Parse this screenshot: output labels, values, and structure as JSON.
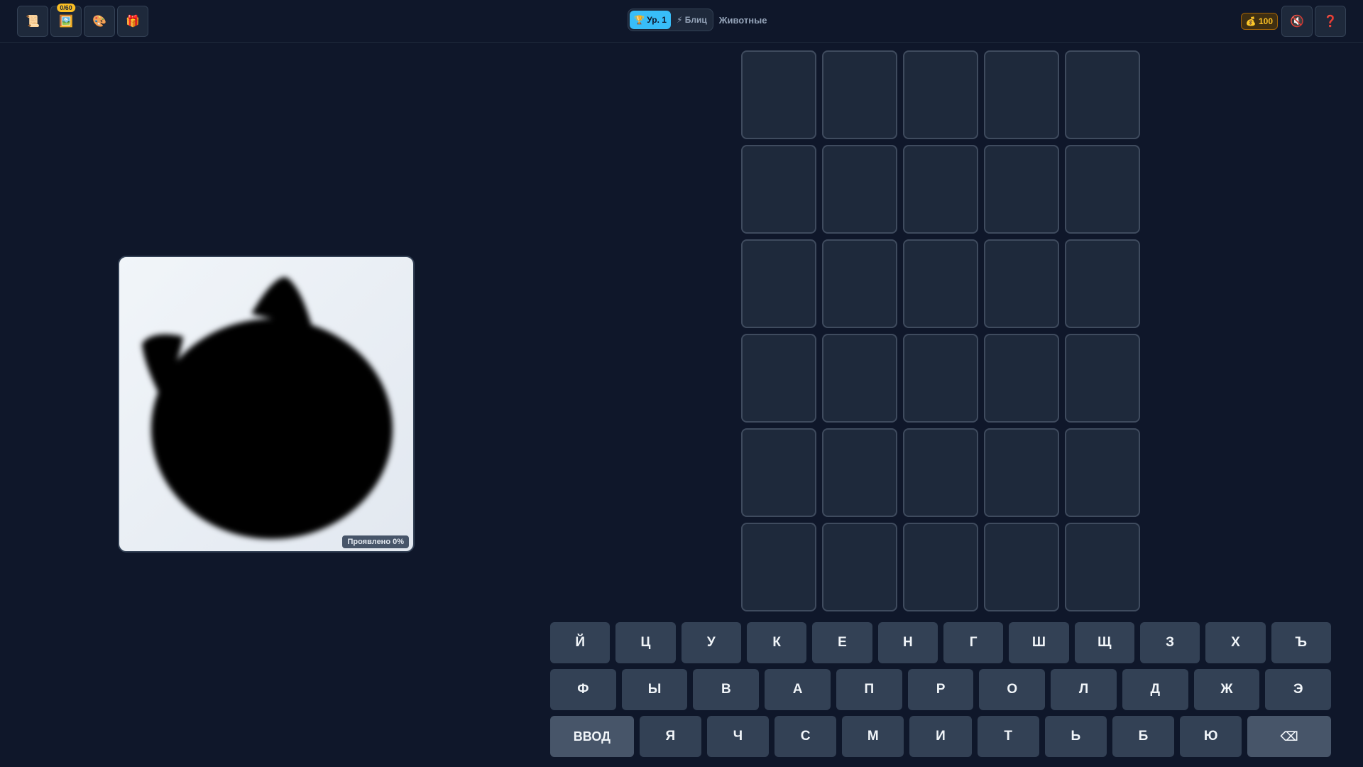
{
  "toolbar_left": [
    {
      "name": "scroll-icon",
      "glyph": "📜"
    },
    {
      "name": "gallery-icon",
      "glyph": "🖼️",
      "badge": "0/60"
    },
    {
      "name": "palette-icon",
      "glyph": "🎨"
    },
    {
      "name": "gift-icon",
      "glyph": "🎁"
    }
  ],
  "modes": {
    "level": "🏆 Ур. 1",
    "blitz": "⚡ Блиц"
  },
  "category": "Животные",
  "coins": "💰 100",
  "toolbar_right": {
    "sound_glyph": "🔇",
    "help_glyph": "❓"
  },
  "image": {
    "revealed_label": "Проявлено 0%",
    "revealed_value": 0
  },
  "grid": {
    "rows": 6,
    "cols": 5
  },
  "keyboard": {
    "row1": [
      "Й",
      "Ц",
      "У",
      "К",
      "Е",
      "Н",
      "Г",
      "Ш",
      "Щ",
      "З",
      "Х",
      "Ъ"
    ],
    "row2": [
      "Ф",
      "Ы",
      "В",
      "А",
      "П",
      "Р",
      "О",
      "Л",
      "Д",
      "Ж",
      "Э"
    ],
    "row3": [
      "ВВОД",
      "Я",
      "Ч",
      "С",
      "М",
      "И",
      "Т",
      "Ь",
      "Б",
      "Ю",
      "⌫"
    ]
  },
  "colors": {
    "accent": "#38bdf8",
    "background": "#0f172a",
    "coin": "#fbbf24"
  }
}
